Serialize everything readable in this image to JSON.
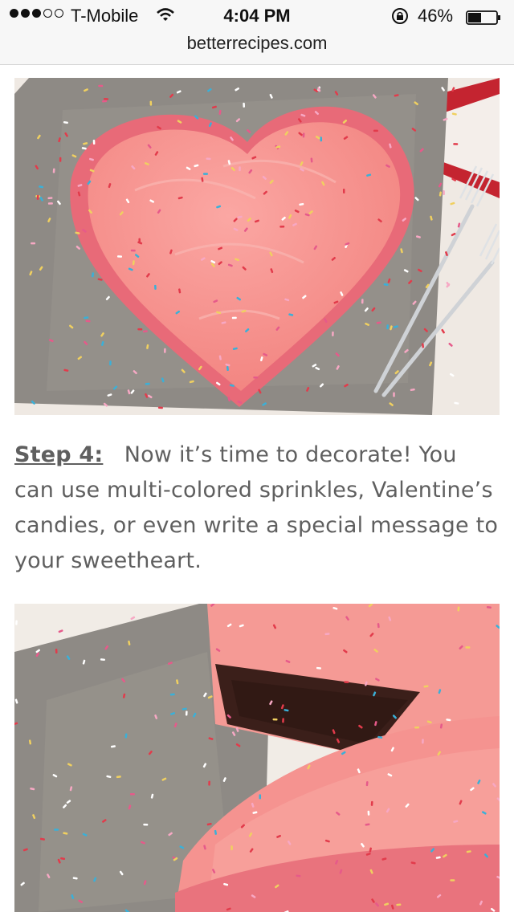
{
  "status_bar": {
    "signal_dots_filled": 3,
    "signal_dots_total": 5,
    "carrier": "T-Mobile",
    "time": "4:04 PM",
    "battery_percent": "46%",
    "battery_level": 0.46,
    "icons": [
      "wifi-icon",
      "orientation-lock-icon",
      "battery-icon"
    ]
  },
  "url_bar": {
    "domain": "betterrecipes.com"
  },
  "content": {
    "step_label": "Step 4:",
    "step_text": "Now it’s time to decorate!  You can use multi-colored sprinkles, Valentine’s candies, or even write a special message to your sweetheart."
  },
  "colors": {
    "frosting": "#f59390",
    "board": "#8e8a85",
    "napkin": "#c42430",
    "cake": "#3b1f1a",
    "text": "#5f5f5f"
  }
}
